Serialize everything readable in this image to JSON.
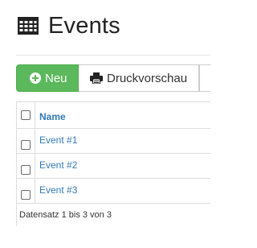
{
  "header": {
    "title": "Events",
    "icon": "table-grid-icon"
  },
  "toolbar": {
    "new_label": "Neu",
    "new_icon": "plus-circle-icon",
    "print_label": "Druckvorschau",
    "print_icon": "printer-icon",
    "new_color": "#5cb85c"
  },
  "table": {
    "columns": [
      "Name"
    ],
    "rows": [
      {
        "name": "Event #1"
      },
      {
        "name": "Event #2"
      },
      {
        "name": "Event #3"
      }
    ],
    "footer": "Datensatz 1 bis 3 von 3",
    "link_color": "#337ab7"
  }
}
